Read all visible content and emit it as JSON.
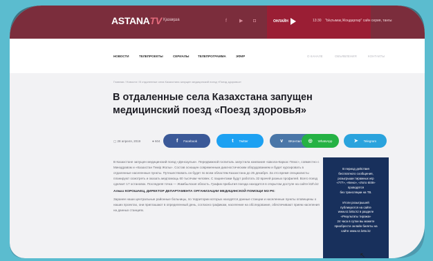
{
  "header": {
    "logo_main": "ASTANA",
    "logo_tv": "TV",
    "language": "Қазақша",
    "social_icons": [
      "facebook-icon",
      "youtube-icon",
      "instagram-icon"
    ],
    "live_label": "ОНЛАЙН",
    "time": "13:30",
    "now_playing": "\"Ыңтымақ Жоңдарлар\" сайн серия, тангы"
  },
  "nav": {
    "items": [
      "НОВОСТИ",
      "ТЕЛЕПРОЕКТЫ",
      "СЕРИАЛЫ",
      "ТЕЛЕПРОГРАММА",
      "ЭФИР"
    ],
    "right_items": [
      "О КАНАЛЕ",
      "ОБЪЯВЛЕНИЯ",
      "КОНТАКТЫ"
    ]
  },
  "article": {
    "breadcrumb": "Главная / Новости / В отдаленные села Казахстана запущен медицинский поезд «Поезд здоровья»",
    "title": "В отдаленные села Казахстана запущен медицинский поезд «Поезд здоровья»",
    "date": "28 апреля, 2019",
    "views": "604",
    "share": [
      {
        "label": "Facebook",
        "icon": "facebook-icon",
        "color": "#3b5998"
      },
      {
        "label": "Twitter",
        "icon": "twitter-icon",
        "color": "#1da1f2"
      },
      {
        "label": "ВКонтакте",
        "icon": "vk-icon",
        "color": "#4a76a8"
      },
      {
        "label": "WhatsApp",
        "icon": "whatsapp-icon",
        "color": "#25b244"
      },
      {
        "label": "Telegram",
        "icon": "telegram-icon",
        "color": "#2aa3dd"
      }
    ],
    "body_1": "В Казахстане запущен медицинский поезд «Денсаулык». Передвижной госпиталь запустила компания «Школа-Каркас Плюс», совместно с Минздравом и «Казахстан Темiр Жолы». Состав оснащен современным диагностическим оборудованием и будет курсировать в отдаленные населенные пункты. Путешествовать он будет по всем областям Казахстана до 25 декабря. За это время специалисты планируют осмотреть и оказать медпомощь 60 тысячам человек. С пациентами будут работать 32 врачей разных профилей. Всего поезд сделает 17 остановок. Последняя точка — Жамбылская область. График прибытия поезда находится в открытом доступе на сайте ktzh.kz",
    "quote_heading": "Алмаз КОРОШАЕЦ, ДИРЕКТОР ДЕПАРТАМЕНТА ОРГАНИЗАЦИИ МЕДИЦИНСКОЙ ПОМОЩИ МЗ РК:",
    "body_2": "Заранее наши центральные районные больницы, по территории которых находятся данные станции и населенные пункты оповещены о наших проектах, они приглашают в определенный день, согласно графикам, население на обследование, обеспечивают прием населения на данных станциях."
  },
  "banner": {
    "lines_1": [
      "В период действия",
      "бесплатного сообщения,",
      "розыгрыши тиражных игр",
      "«777», «Кено», «Лото 6/49»",
      "проводятся",
      "без трансляции на ТВ."
    ],
    "lines_2": [
      "Итоги розыгрышей",
      "публикуются на сайте",
      "www.sz.lotto.kz в разделе",
      "«Результаты тиража»",
      "24 часа в сутки вы можете",
      "приобрести онлайн билеты на",
      "сайте www.sz.lotto.kz"
    ]
  }
}
